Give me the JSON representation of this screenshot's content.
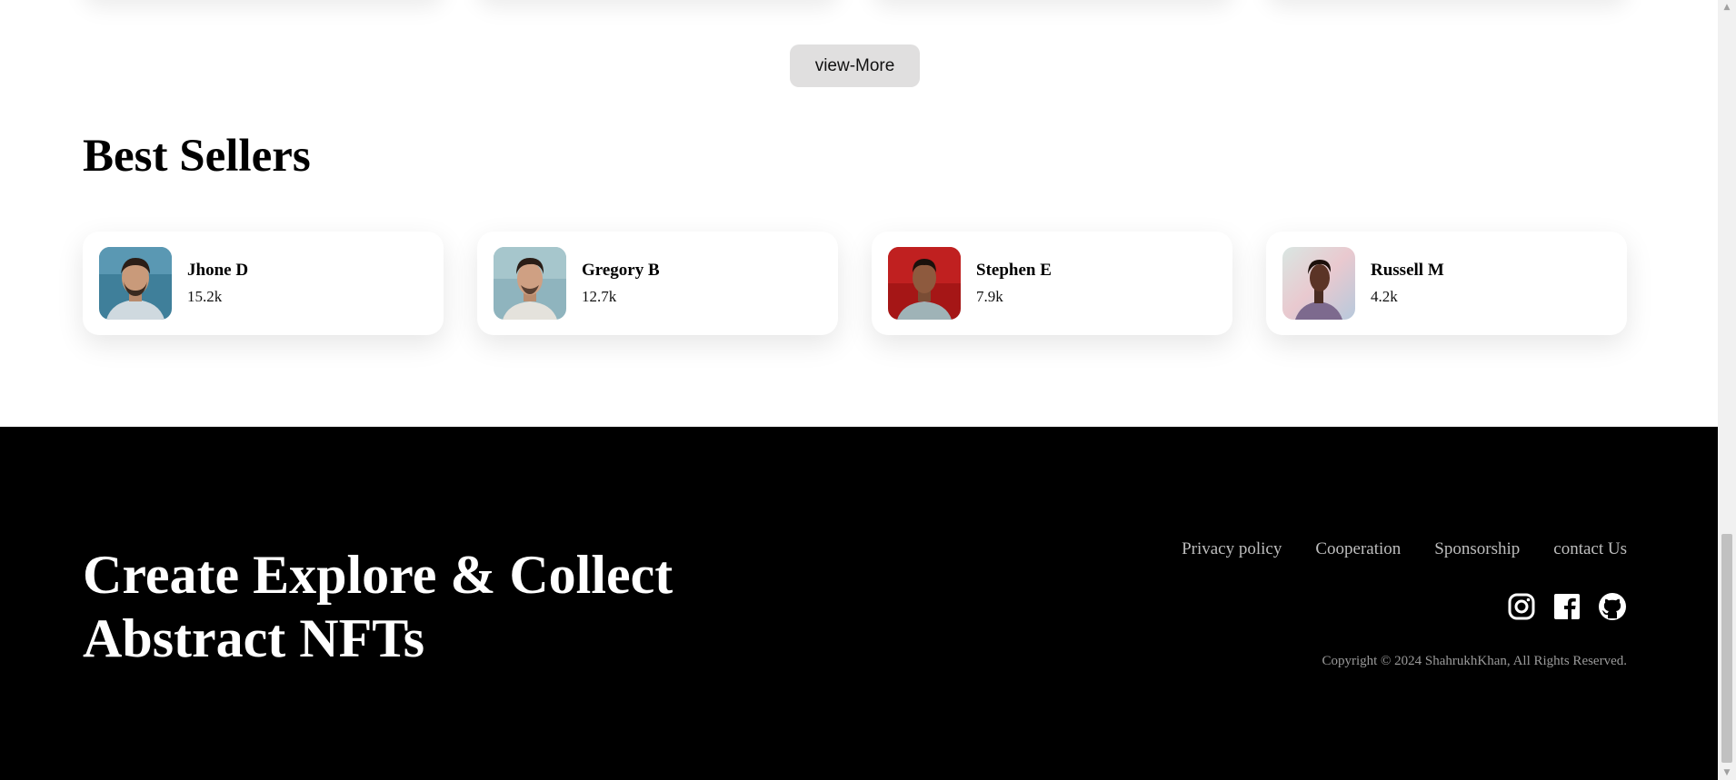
{
  "view_more": {
    "label": "view-More"
  },
  "best_sellers": {
    "title": "Best Sellers",
    "sellers": [
      {
        "name": "Jhone D",
        "count": "15.2k"
      },
      {
        "name": "Gregory B",
        "count": "12.7k"
      },
      {
        "name": "Stephen E",
        "count": "7.9k"
      },
      {
        "name": "Russell M",
        "count": "4.2k"
      }
    ]
  },
  "footer": {
    "headline_line1": "Create Explore & Collect",
    "headline_line2": "Abstract NFTs",
    "links": [
      "Privacy policy",
      "Cooperation",
      "Sponsorship",
      "contact Us"
    ],
    "social_icons": [
      "instagram-icon",
      "facebook-icon",
      "github-icon"
    ],
    "copyright": "Copyright © 2024 ShahrukhKhan, All Rights Reserved."
  },
  "colors": {
    "footer_bg": "#000000",
    "button_bg": "#e0dfdf",
    "link_color": "#bdbdbd"
  }
}
